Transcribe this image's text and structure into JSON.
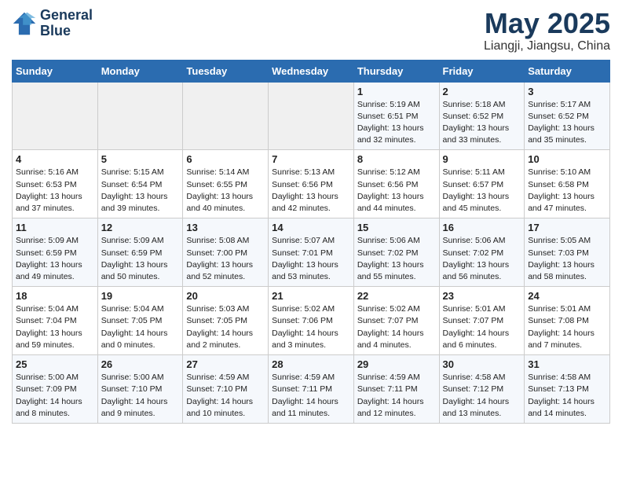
{
  "header": {
    "logo_line1": "General",
    "logo_line2": "Blue",
    "month_year": "May 2025",
    "location": "Liangji, Jiangsu, China"
  },
  "weekdays": [
    "Sunday",
    "Monday",
    "Tuesday",
    "Wednesday",
    "Thursday",
    "Friday",
    "Saturday"
  ],
  "weeks": [
    [
      {
        "day": "",
        "info": ""
      },
      {
        "day": "",
        "info": ""
      },
      {
        "day": "",
        "info": ""
      },
      {
        "day": "",
        "info": ""
      },
      {
        "day": "1",
        "info": "Sunrise: 5:19 AM\nSunset: 6:51 PM\nDaylight: 13 hours\nand 32 minutes."
      },
      {
        "day": "2",
        "info": "Sunrise: 5:18 AM\nSunset: 6:52 PM\nDaylight: 13 hours\nand 33 minutes."
      },
      {
        "day": "3",
        "info": "Sunrise: 5:17 AM\nSunset: 6:52 PM\nDaylight: 13 hours\nand 35 minutes."
      }
    ],
    [
      {
        "day": "4",
        "info": "Sunrise: 5:16 AM\nSunset: 6:53 PM\nDaylight: 13 hours\nand 37 minutes."
      },
      {
        "day": "5",
        "info": "Sunrise: 5:15 AM\nSunset: 6:54 PM\nDaylight: 13 hours\nand 39 minutes."
      },
      {
        "day": "6",
        "info": "Sunrise: 5:14 AM\nSunset: 6:55 PM\nDaylight: 13 hours\nand 40 minutes."
      },
      {
        "day": "7",
        "info": "Sunrise: 5:13 AM\nSunset: 6:56 PM\nDaylight: 13 hours\nand 42 minutes."
      },
      {
        "day": "8",
        "info": "Sunrise: 5:12 AM\nSunset: 6:56 PM\nDaylight: 13 hours\nand 44 minutes."
      },
      {
        "day": "9",
        "info": "Sunrise: 5:11 AM\nSunset: 6:57 PM\nDaylight: 13 hours\nand 45 minutes."
      },
      {
        "day": "10",
        "info": "Sunrise: 5:10 AM\nSunset: 6:58 PM\nDaylight: 13 hours\nand 47 minutes."
      }
    ],
    [
      {
        "day": "11",
        "info": "Sunrise: 5:09 AM\nSunset: 6:59 PM\nDaylight: 13 hours\nand 49 minutes."
      },
      {
        "day": "12",
        "info": "Sunrise: 5:09 AM\nSunset: 6:59 PM\nDaylight: 13 hours\nand 50 minutes."
      },
      {
        "day": "13",
        "info": "Sunrise: 5:08 AM\nSunset: 7:00 PM\nDaylight: 13 hours\nand 52 minutes."
      },
      {
        "day": "14",
        "info": "Sunrise: 5:07 AM\nSunset: 7:01 PM\nDaylight: 13 hours\nand 53 minutes."
      },
      {
        "day": "15",
        "info": "Sunrise: 5:06 AM\nSunset: 7:02 PM\nDaylight: 13 hours\nand 55 minutes."
      },
      {
        "day": "16",
        "info": "Sunrise: 5:06 AM\nSunset: 7:02 PM\nDaylight: 13 hours\nand 56 minutes."
      },
      {
        "day": "17",
        "info": "Sunrise: 5:05 AM\nSunset: 7:03 PM\nDaylight: 13 hours\nand 58 minutes."
      }
    ],
    [
      {
        "day": "18",
        "info": "Sunrise: 5:04 AM\nSunset: 7:04 PM\nDaylight: 13 hours\nand 59 minutes."
      },
      {
        "day": "19",
        "info": "Sunrise: 5:04 AM\nSunset: 7:05 PM\nDaylight: 14 hours\nand 0 minutes."
      },
      {
        "day": "20",
        "info": "Sunrise: 5:03 AM\nSunset: 7:05 PM\nDaylight: 14 hours\nand 2 minutes."
      },
      {
        "day": "21",
        "info": "Sunrise: 5:02 AM\nSunset: 7:06 PM\nDaylight: 14 hours\nand 3 minutes."
      },
      {
        "day": "22",
        "info": "Sunrise: 5:02 AM\nSunset: 7:07 PM\nDaylight: 14 hours\nand 4 minutes."
      },
      {
        "day": "23",
        "info": "Sunrise: 5:01 AM\nSunset: 7:07 PM\nDaylight: 14 hours\nand 6 minutes."
      },
      {
        "day": "24",
        "info": "Sunrise: 5:01 AM\nSunset: 7:08 PM\nDaylight: 14 hours\nand 7 minutes."
      }
    ],
    [
      {
        "day": "25",
        "info": "Sunrise: 5:00 AM\nSunset: 7:09 PM\nDaylight: 14 hours\nand 8 minutes."
      },
      {
        "day": "26",
        "info": "Sunrise: 5:00 AM\nSunset: 7:10 PM\nDaylight: 14 hours\nand 9 minutes."
      },
      {
        "day": "27",
        "info": "Sunrise: 4:59 AM\nSunset: 7:10 PM\nDaylight: 14 hours\nand 10 minutes."
      },
      {
        "day": "28",
        "info": "Sunrise: 4:59 AM\nSunset: 7:11 PM\nDaylight: 14 hours\nand 11 minutes."
      },
      {
        "day": "29",
        "info": "Sunrise: 4:59 AM\nSunset: 7:11 PM\nDaylight: 14 hours\nand 12 minutes."
      },
      {
        "day": "30",
        "info": "Sunrise: 4:58 AM\nSunset: 7:12 PM\nDaylight: 14 hours\nand 13 minutes."
      },
      {
        "day": "31",
        "info": "Sunrise: 4:58 AM\nSunset: 7:13 PM\nDaylight: 14 hours\nand 14 minutes."
      }
    ]
  ]
}
